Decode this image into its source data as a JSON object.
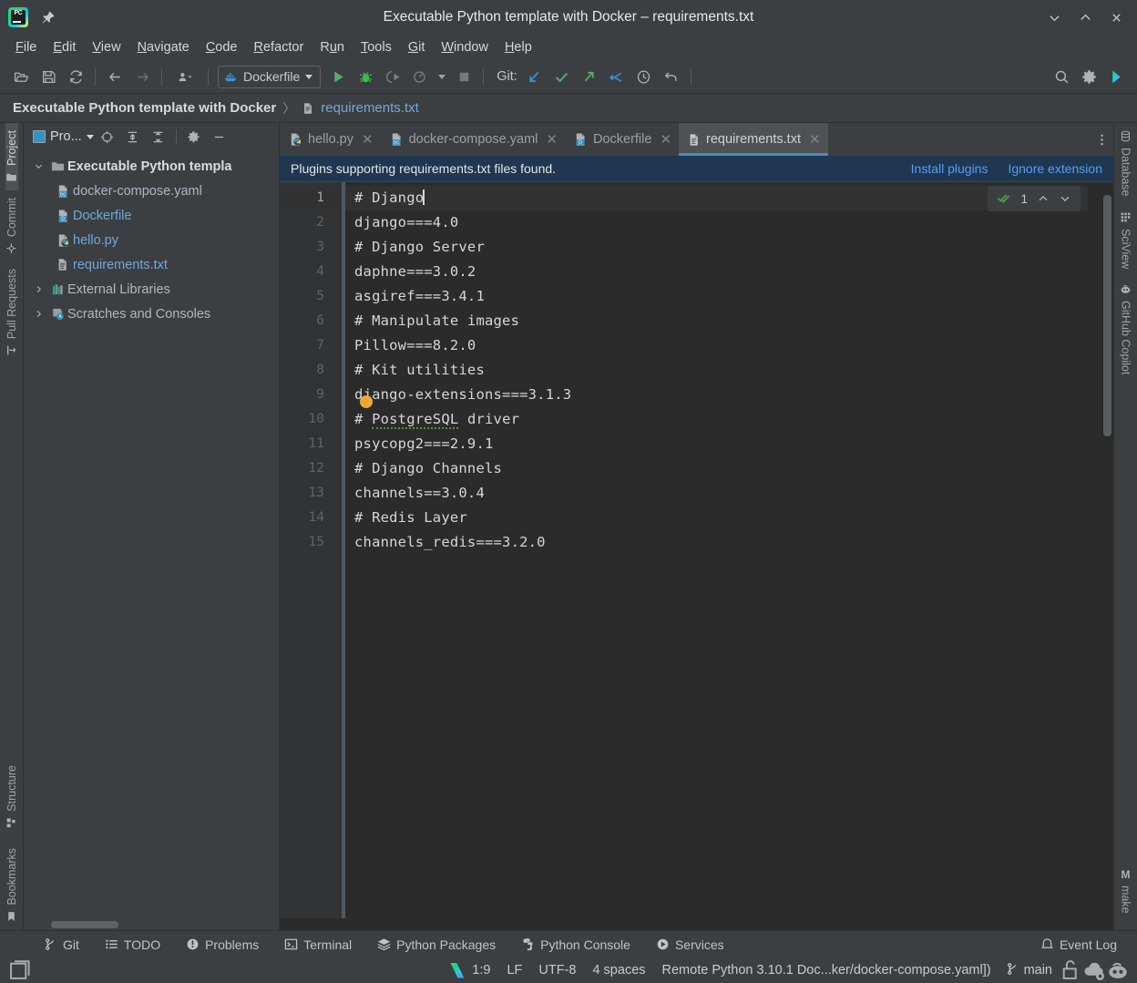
{
  "window": {
    "title": "Executable Python template with Docker – requirements.txt",
    "logo_text": "PC",
    "pin_icon": "pin-icon",
    "minimize_icon": "minimize-icon",
    "maximize_icon": "maximize-icon",
    "close_icon": "close-icon"
  },
  "menubar": {
    "items": [
      {
        "label": "File",
        "mnemonic": "F"
      },
      {
        "label": "Edit",
        "mnemonic": "E"
      },
      {
        "label": "View",
        "mnemonic": "V"
      },
      {
        "label": "Navigate",
        "mnemonic": "N"
      },
      {
        "label": "Code",
        "mnemonic": "C"
      },
      {
        "label": "Refactor",
        "mnemonic": "R"
      },
      {
        "label": "Run",
        "mnemonic": "u"
      },
      {
        "label": "Tools",
        "mnemonic": "T"
      },
      {
        "label": "Git",
        "mnemonic": "G"
      },
      {
        "label": "Window",
        "mnemonic": "W"
      },
      {
        "label": "Help",
        "mnemonic": "H"
      }
    ]
  },
  "toolbar": {
    "open_icon": "open-folder-icon",
    "save_icon": "save-icon",
    "sync_icon": "refresh-icon",
    "back_icon": "arrow-left-icon",
    "forward_icon": "arrow-right-icon",
    "profile_icon": "user-profile-icon",
    "run_config_label": "Dockerfile",
    "run_config_icon": "docker-icon",
    "run_icon": "run-play-icon",
    "debug_icon": "debug-bug-icon",
    "coverage_icon": "run-with-coverage-icon",
    "profile_run_icon": "profile-icon",
    "stop_icon": "stop-icon",
    "git_label": "Git:",
    "git_update_icon": "git-update-project-icon",
    "git_commit_icon": "git-commit-icon",
    "git_push_icon": "git-push-icon",
    "git_rebase_icon": "git-rebase-icon",
    "git_history_icon": "git-history-icon",
    "git_revert_icon": "git-rollback-icon",
    "search_icon": "search-everywhere-icon",
    "settings_icon": "gear-icon",
    "copilot_icon": "ide-assistant-icon"
  },
  "breadcrumb": {
    "project": "Executable Python template with Docker",
    "separator": "〉",
    "file": "requirements.txt",
    "file_icon": "text-file-icon"
  },
  "left_stripe": {
    "top": [
      {
        "label": "Project",
        "icon": "project-folder-icon",
        "active": true
      },
      {
        "label": "Commit",
        "icon": "commit-icon",
        "active": false
      },
      {
        "label": "Pull Requests",
        "icon": "pull-request-icon",
        "active": false
      }
    ],
    "bottom": [
      {
        "label": "Structure",
        "icon": "structure-icon",
        "active": false
      },
      {
        "label": "Bookmarks",
        "icon": "bookmark-icon",
        "active": false
      }
    ]
  },
  "right_stripe": {
    "top": [
      {
        "label": "Database",
        "icon": "database-icon",
        "active": false
      },
      {
        "label": "SciView",
        "icon": "sciview-icon",
        "active": false
      },
      {
        "label": "GitHub Copilot",
        "icon": "copilot-icon",
        "active": false
      }
    ],
    "bottom": [
      {
        "label": "make",
        "icon": "make-icon",
        "active": false
      }
    ]
  },
  "project_panel": {
    "title": "Pro...",
    "title_icon": "project-window-icon",
    "dropdown_icon": "chevron-down-icon",
    "locate_icon": "select-opened-file-icon",
    "expand_icon": "expand-all-icon",
    "collapse_icon": "collapse-all-icon",
    "settings_icon": "gear-icon",
    "hide_icon": "hide-panel-icon",
    "tree": [
      {
        "label": "Executable Python templa",
        "kind": "root",
        "icon": "folder-icon",
        "arrow": "expanded",
        "indent": 0
      },
      {
        "label": "docker-compose.yaml",
        "kind": "file",
        "icon": "docker-compose-file-icon",
        "arrow": "none",
        "indent": 1
      },
      {
        "label": "Dockerfile",
        "kind": "file",
        "icon": "dockerfile-icon",
        "arrow": "none",
        "indent": 1
      },
      {
        "label": "hello.py",
        "kind": "file",
        "icon": "python-file-icon",
        "arrow": "none",
        "indent": 1
      },
      {
        "label": "requirements.txt",
        "kind": "file",
        "icon": "text-file-icon",
        "arrow": "none",
        "indent": 1
      },
      {
        "label": "External Libraries",
        "kind": "plain",
        "icon": "library-icon",
        "arrow": "collapsed",
        "indent": 0
      },
      {
        "label": "Scratches and Consoles",
        "kind": "plain",
        "icon": "scratches-icon",
        "arrow": "collapsed",
        "indent": 0
      }
    ]
  },
  "editor_tabs": {
    "more_icon": "more-options-icon",
    "close_icon": "close-icon",
    "tabs": [
      {
        "label": "hello.py",
        "icon": "python-file-icon",
        "active": false
      },
      {
        "label": "docker-compose.yaml",
        "icon": "docker-compose-file-icon",
        "active": false
      },
      {
        "label": "Dockerfile",
        "icon": "dockerfile-icon",
        "active": false
      },
      {
        "label": "requirements.txt",
        "icon": "text-file-icon",
        "active": true
      }
    ]
  },
  "notification": {
    "message": "Plugins supporting requirements.txt files found.",
    "install_label": "Install plugins",
    "ignore_label": "Ignore extension"
  },
  "inspection_widget": {
    "status_icon": "inspection-ok-icon",
    "count": "1",
    "prev_icon": "chevron-up-icon",
    "next_icon": "chevron-down-icon"
  },
  "editor": {
    "breakpoint_icon": "breakpoint-icon",
    "lines": [
      {
        "n": "1",
        "text": "# Django",
        "cursor": true,
        "current": true,
        "typo": null
      },
      {
        "n": "2",
        "text": "django===4.0",
        "cursor": false,
        "current": false,
        "typo": null
      },
      {
        "n": "3",
        "text": "# Django Server",
        "cursor": false,
        "current": false,
        "typo": null
      },
      {
        "n": "4",
        "text": "daphne===3.0.2",
        "cursor": false,
        "current": false,
        "typo": null
      },
      {
        "n": "5",
        "text": "asgiref===3.4.1",
        "cursor": false,
        "current": false,
        "typo": null
      },
      {
        "n": "6",
        "text": "# Manipulate images",
        "cursor": false,
        "current": false,
        "typo": null
      },
      {
        "n": "7",
        "text": "Pillow===8.2.0",
        "cursor": false,
        "current": false,
        "typo": null
      },
      {
        "n": "8",
        "text": "# Kit utilities",
        "cursor": false,
        "current": false,
        "typo": null
      },
      {
        "n": "9",
        "text": "django-extensions===3.1.3",
        "cursor": false,
        "current": false,
        "typo": null
      },
      {
        "n": "10",
        "text": "# PostgreSQL driver",
        "cursor": false,
        "current": false,
        "typo": "PostgreSQL"
      },
      {
        "n": "11",
        "text": "psycopg2===2.9.1",
        "cursor": false,
        "current": false,
        "typo": null
      },
      {
        "n": "12",
        "text": "# Django Channels",
        "cursor": false,
        "current": false,
        "typo": null
      },
      {
        "n": "13",
        "text": "channels==3.0.4",
        "cursor": false,
        "current": false,
        "typo": null
      },
      {
        "n": "14",
        "text": "# Redis Layer",
        "cursor": false,
        "current": false,
        "typo": null
      },
      {
        "n": "15",
        "text": "channels_redis===3.2.0",
        "cursor": false,
        "current": false,
        "typo": null
      }
    ]
  },
  "bottom_toolwindows": {
    "items": [
      {
        "label": "Git",
        "icon": "git-branch-icon"
      },
      {
        "label": "TODO",
        "icon": "todo-list-icon"
      },
      {
        "label": "Problems",
        "icon": "problems-icon"
      },
      {
        "label": "Terminal",
        "icon": "terminal-icon"
      },
      {
        "label": "Python Packages",
        "icon": "packages-icon"
      },
      {
        "label": "Python Console",
        "icon": "python-console-icon"
      },
      {
        "label": "Services",
        "icon": "services-icon"
      }
    ],
    "event_log": {
      "label": "Event Log",
      "icon": "event-log-icon"
    }
  },
  "statusbar": {
    "toggle_icon": "toggle-toolwindows-icon",
    "indexing_icon": "pycharm-status-icon",
    "caret_position": "1:9",
    "line_separator": "LF",
    "encoding": "UTF-8",
    "indent": "4 spaces",
    "interpreter": "Remote Python 3.10.1 Doc...ker/docker-compose.yaml])",
    "branch": "main",
    "branch_icon": "git-branch-icon",
    "lock_icon": "unlocked-icon",
    "cloud_icon": "cloud-settings-icon",
    "copilot_icon": "copilot-status-icon"
  },
  "colors": {
    "panel_bg": "#3c3f41",
    "editor_bg": "#2b2b2b",
    "gutter_bg": "#313335",
    "accent_blue": "#4a88c7",
    "link_blue": "#589df6",
    "file_blue": "#6fa8dc",
    "notification_bg": "#1f3750",
    "breakpoint_orange": "#f0a732",
    "ok_green": "#4f9d4f"
  }
}
